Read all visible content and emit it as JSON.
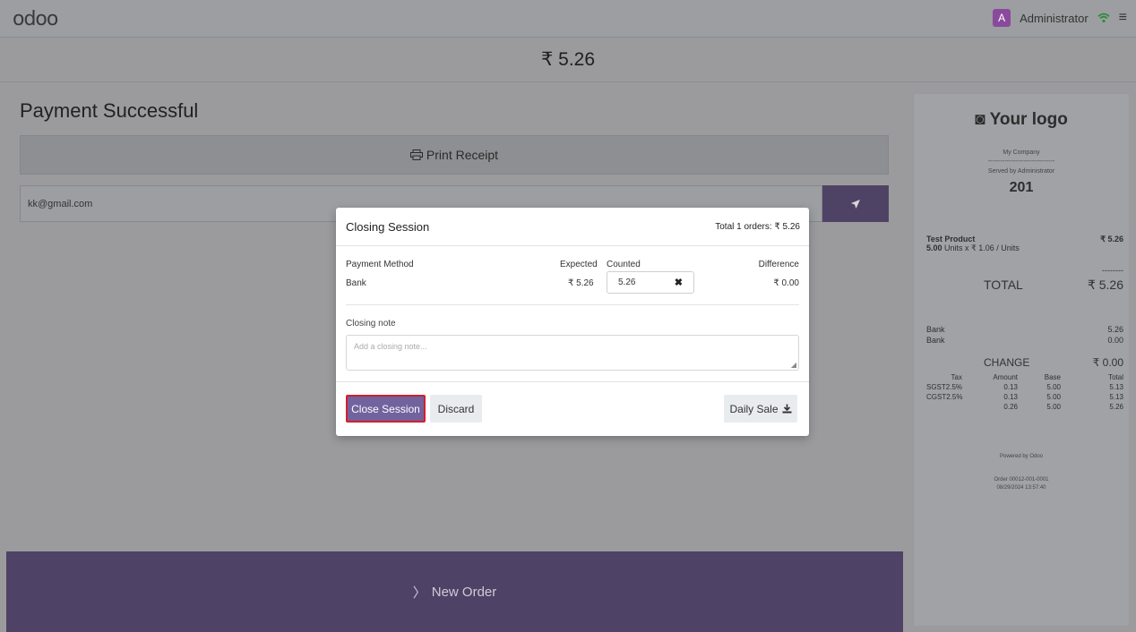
{
  "navbar": {
    "logo": "odoo",
    "avatar_letter": "A",
    "user": "Administrator"
  },
  "header": {
    "total": "₹ 5.26"
  },
  "main": {
    "title": "Payment Successful",
    "print_receipt": "Print Receipt",
    "email_value": "kk@gmail.com",
    "new_order": "New Order"
  },
  "modal": {
    "title": "Closing Session",
    "total_orders": "Total 1 orders: ₹ 5.26",
    "col_method": "Payment Method",
    "col_expected": "Expected",
    "col_counted": "Counted",
    "col_difference": "Difference",
    "row_method": "Bank",
    "row_expected": "₹ 5.26",
    "row_counted": "5.26",
    "row_difference": "₹ 0.00",
    "note_label": "Closing note",
    "note_placeholder": "Add a closing note...",
    "btn_close": "Close Session",
    "btn_discard": "Discard",
    "btn_daily": "Daily Sale"
  },
  "receipt": {
    "logo": "Your logo",
    "company": "My Company",
    "separator": "--------------------------------",
    "served_by": "Served by Administrator",
    "number": "201",
    "product": "Test Product",
    "product_price": "₹ 5.26",
    "product_qty_num": "5.00",
    "product_qty_rest": " Units x ₹ 1.06 / Units",
    "dashes": "--------",
    "total_label": "TOTAL",
    "total_value": "₹ 5.26",
    "payments": [
      {
        "label": "Bank",
        "value": "5.26"
      },
      {
        "label": "Bank",
        "value": "0.00"
      }
    ],
    "change_label": "CHANGE",
    "change_value": "₹ 0.00",
    "tax_header": [
      "Tax",
      "Amount",
      "Base",
      "Total"
    ],
    "tax_rows": [
      [
        "SGST2.5%",
        "0.13",
        "5.00",
        "5.13"
      ],
      [
        "CGST2.5%",
        "0.13",
        "5.00",
        "5.13"
      ],
      [
        "",
        "0.26",
        "5.00",
        "5.26"
      ]
    ],
    "powered": "Powered by Odoo",
    "order": "Order 00012-001-0001",
    "date": "08/29/2024 13:57:40"
  }
}
